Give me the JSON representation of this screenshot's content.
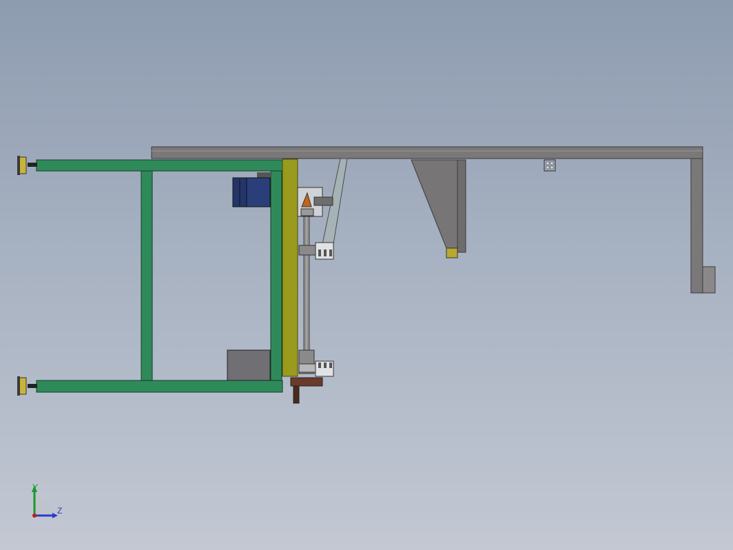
{
  "viewport": {
    "background_top": "#8e9cb0",
    "background_bottom": "#c3c8d3"
  },
  "colors": {
    "frame_green": "#2f8a5a",
    "frame_green_dark": "#1f5a3a",
    "plate_olive": "#9a9a1e",
    "beam_gray": "#7a7878",
    "beam_gray_dark": "#4e4c4c",
    "motor_blue": "#2a3f7a",
    "box_gray": "#6f6f74",
    "foot_yellow": "#c9b43a",
    "rust_brown": "#6a3a2a",
    "axis_y": "#1a9a2a",
    "axis_z": "#2a3acc",
    "axis_origin": "#c01a1a"
  },
  "triad": {
    "y_label": "Y",
    "z_label": "Z",
    "icon": "coordinate-triad-icon"
  }
}
